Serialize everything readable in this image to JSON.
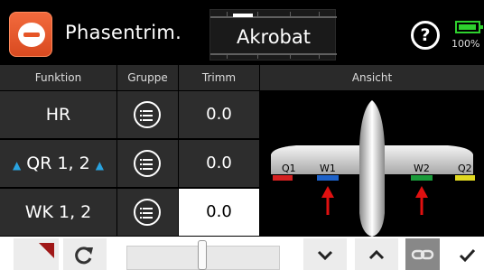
{
  "header": {
    "app_icon": "phase-trim-icon",
    "title": "Phasentrim.",
    "model_name": "Akrobat",
    "help_label": "?",
    "battery_percent": "100%",
    "battery_color": "#2ed12e",
    "accent": "#e65527"
  },
  "table": {
    "columns": [
      "Funktion",
      "Gruppe",
      "Trimm",
      "Ansicht"
    ],
    "rows": [
      {
        "function": "HR",
        "group_icon": "group-list-icon",
        "trim": "0.0",
        "marker": false,
        "selected": false
      },
      {
        "function": "QR 1, 2",
        "group_icon": "group-list-icon",
        "trim": "0.0",
        "marker": true,
        "selected": false
      },
      {
        "function": "WK 1, 2",
        "group_icon": "group-list-icon",
        "trim": "0.0",
        "marker": false,
        "selected": true
      }
    ],
    "marker_color": "#29a3e0"
  },
  "ansicht": {
    "surfaces": [
      {
        "label": "Q1",
        "color": "#d42020"
      },
      {
        "label": "W1",
        "color": "#1e62c8"
      },
      {
        "label": "W2",
        "color": "#1a9a3a"
      },
      {
        "label": "Q2",
        "color": "#e0d820"
      }
    ],
    "arrow_color": "#e01010"
  },
  "toolbar": {
    "items": [
      "corner-flag-icon",
      "refresh-icon",
      "slider",
      "chevron-down-icon",
      "chevron-up-icon",
      "link-icon",
      "checkmark-icon"
    ]
  }
}
